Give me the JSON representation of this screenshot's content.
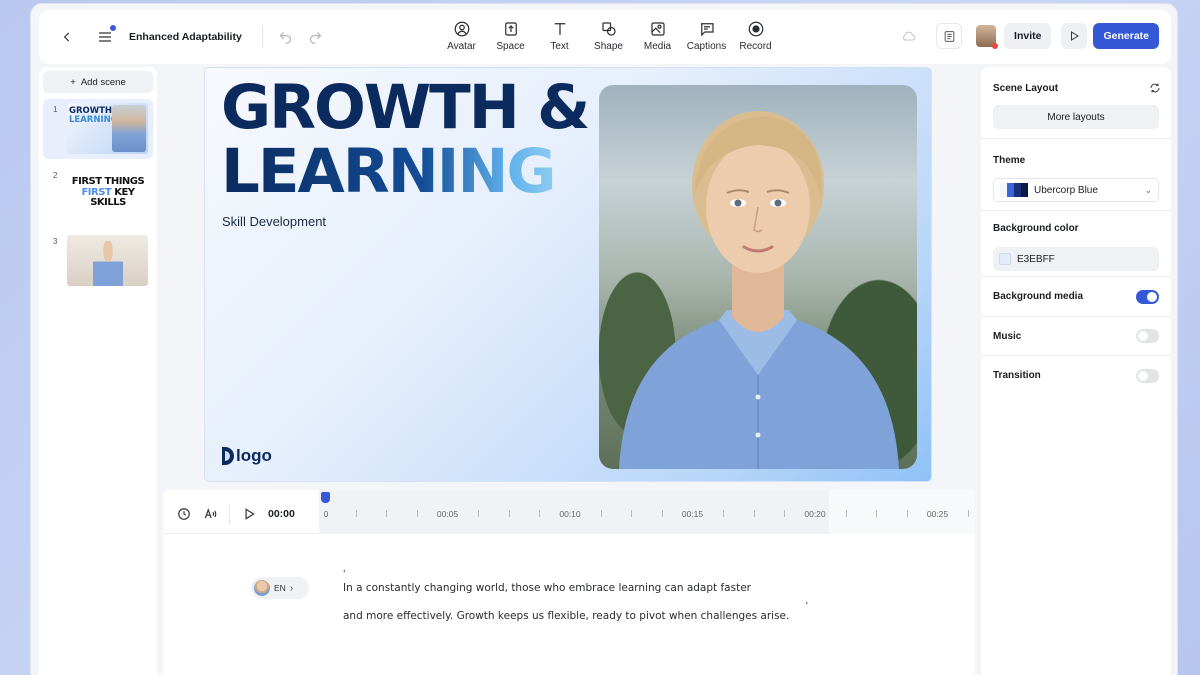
{
  "header": {
    "project_title": "Enhanced Adaptability",
    "tools": [
      {
        "label": "Avatar",
        "icon": "avatar-icon"
      },
      {
        "label": "Space",
        "icon": "space-icon"
      },
      {
        "label": "Text",
        "icon": "text-icon"
      },
      {
        "label": "Shape",
        "icon": "shape-icon"
      },
      {
        "label": "Media",
        "icon": "media-icon"
      },
      {
        "label": "Captions",
        "icon": "captions-icon"
      },
      {
        "label": "Record",
        "icon": "record-icon"
      }
    ],
    "invite_label": "Invite",
    "generate_label": "Generate"
  },
  "scenes": {
    "add_label": "Add scene",
    "items": [
      {
        "number": "1",
        "thumb_line1": "GROWTH &",
        "thumb_line2": "LEARNING"
      },
      {
        "number": "2",
        "thumb_line1": "FIRST THINGS",
        "thumb_line2": "FIRST",
        "thumb_line2b": "KEY",
        "thumb_line3": "SKILLS"
      },
      {
        "number": "3"
      }
    ]
  },
  "slide": {
    "title_line1": "GROWTH &",
    "title_line2": "LEARNING",
    "subtitle": "Skill Development",
    "logo_text": "logo"
  },
  "timeline": {
    "current_time": "00:00",
    "marks": [
      "0",
      "00:05",
      "00:10",
      "00:15",
      "00:20",
      "00:25"
    ]
  },
  "script": {
    "voice_language": "EN",
    "line1": "In a constantly changing world, those who embrace learning can adapt faster",
    "line2": "and more effectively. Growth keeps us flexible, ready to pivot when challenges arise."
  },
  "right_panel": {
    "scene_layout_title": "Scene Layout",
    "more_layouts_label": "More layouts",
    "theme_title": "Theme",
    "theme_value": "Ubercorp Blue",
    "theme_swatches": [
      "#f4f6fb",
      "#3c63d8",
      "#1a2f7a",
      "#0b1a45"
    ],
    "bg_color_title": "Background color",
    "bg_color_value": "E3EBFF",
    "bg_color_hex": "#E3EBFF",
    "bg_media_label": "Background media",
    "bg_media_on": true,
    "music_label": "Music",
    "music_on": false,
    "transition_label": "Transition",
    "transition_on": false
  },
  "colors": {
    "accent": "#3458d6",
    "title_navy": "#0b2a5e"
  }
}
